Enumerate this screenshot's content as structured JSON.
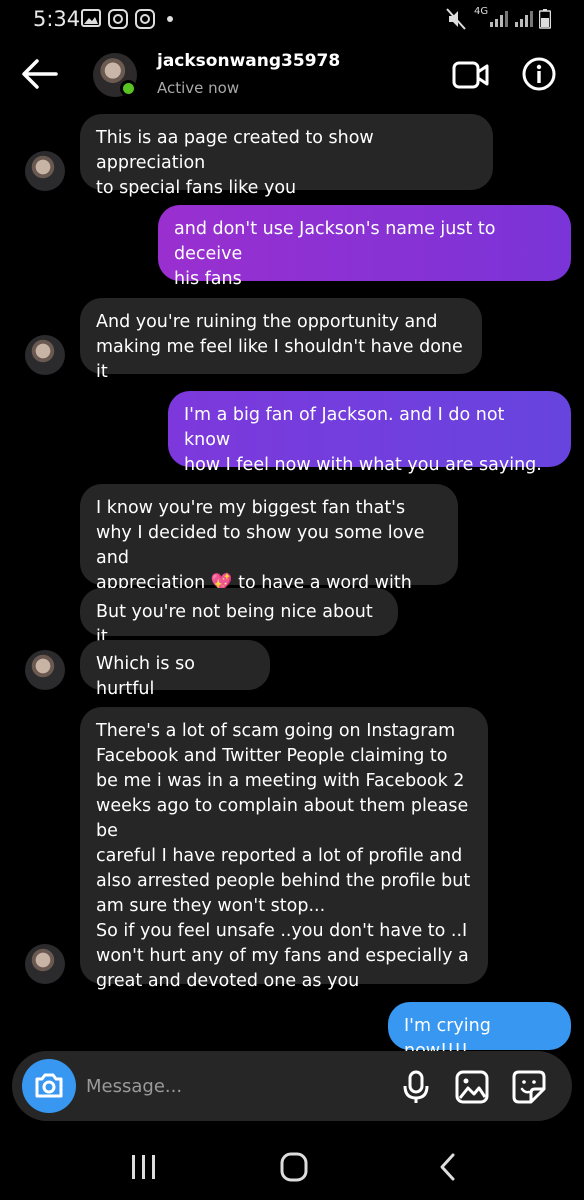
{
  "status_bar": {
    "time": "5:34",
    "network": "4G"
  },
  "header": {
    "username": "jacksonwang35978",
    "status": "Active now"
  },
  "messages": [
    {
      "side": "in",
      "text": "This is aa page created to show appreciation\nto special fans like you"
    },
    {
      "side": "out",
      "text": "and don't use Jackson's name just to deceive\nhis fans"
    },
    {
      "side": "in",
      "text": "And you're ruining the opportunity and\nmaking me feel like I shouldn't have done it"
    },
    {
      "side": "out",
      "text": "I'm a big fan of Jackson. and I do not know\nhow I feel now with what you are saying."
    },
    {
      "side": "in",
      "text": "I know you're my biggest fan that's\nwhy I decided to show you some love and\nappreciation 💖 to have a word with you"
    },
    {
      "side": "in",
      "text": "But you're not being nice about it"
    },
    {
      "side": "in",
      "text": "Which is so hurtful"
    },
    {
      "side": "in",
      "text": "There's a lot of scam going on Instagram\nFacebook and Twitter People claiming to\nbe me i was in a meeting with Facebook 2\nweeks ago to complain about them please be\ncareful I have reported a lot of profile and\nalso arrested people behind the profile but\nam sure they won't stop...\nSo if you feel unsafe ..you don't have to ..I\nwon't hurt any of my fans and especially a\ngreat and devoted one as you"
    },
    {
      "side": "out",
      "text": "I'm crying now!!!!"
    }
  ],
  "composer": {
    "placeholder": "Message..."
  },
  "colors": {
    "incoming_bubble": "#262626",
    "accent_blue": "#3897f0",
    "active_green": "#58c322"
  }
}
